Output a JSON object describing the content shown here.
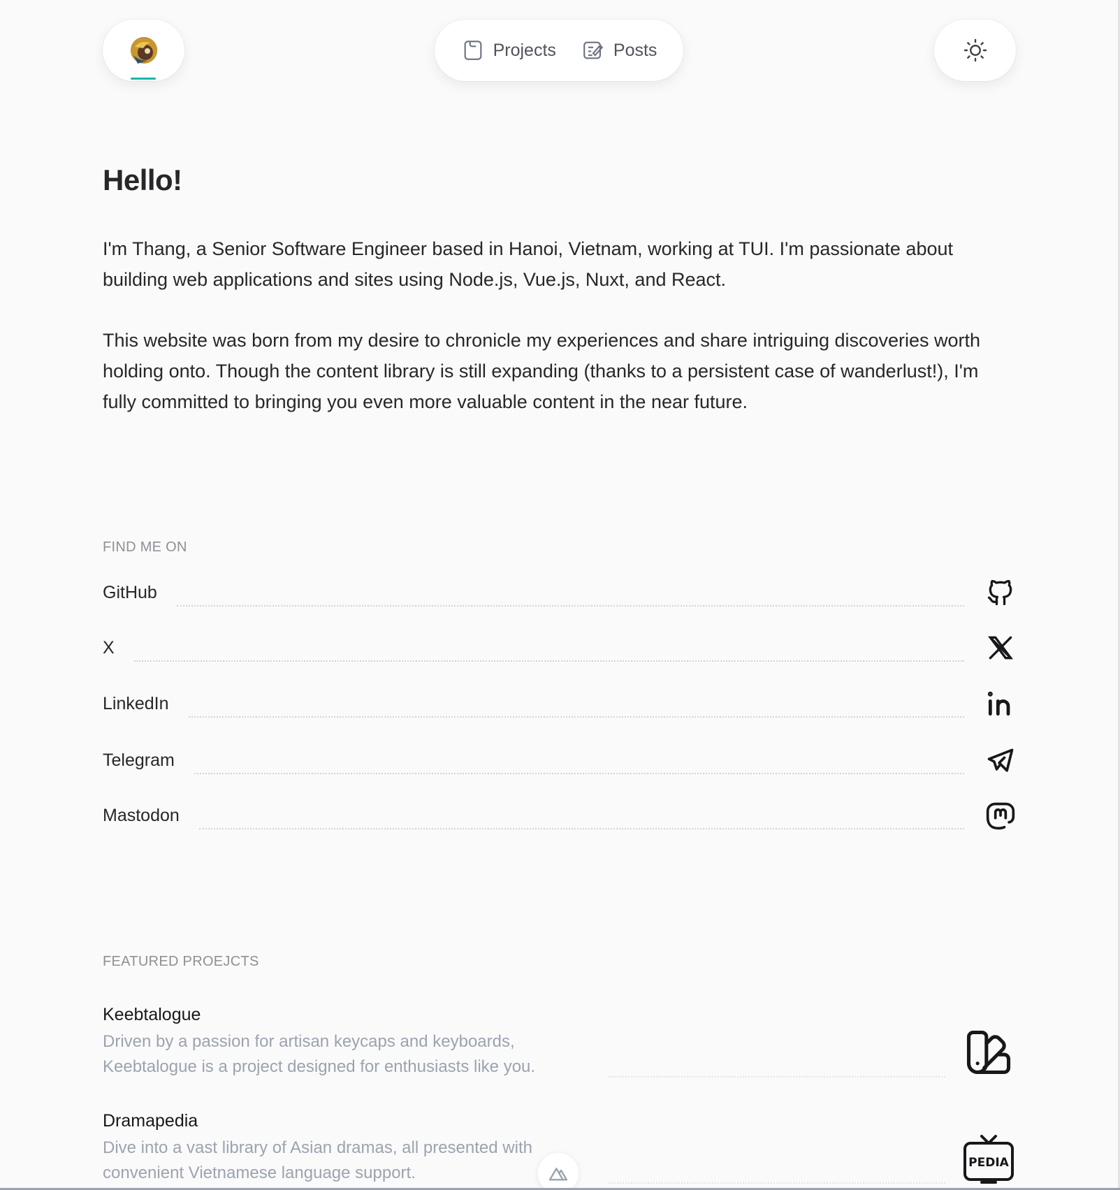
{
  "header": {
    "nav": [
      {
        "label": "Projects",
        "icon": "folder-icon"
      },
      {
        "label": "Posts",
        "icon": "edit-document-icon"
      }
    ],
    "theme_toggle_icon": "sun-icon",
    "accent_color": "#14b8a6"
  },
  "intro": {
    "title": "Hello!",
    "paragraph1": "I'm Thang, a Senior Software Engineer based in Hanoi, Vietnam, working at TUI. I'm passionate about building web applications and sites using Node.js, Vue.js, Nuxt, and React.",
    "paragraph2": "This website was born from my desire to chronicle my experiences and share intriguing discoveries worth holding onto. Though the content library is still expanding (thanks to a persistent case of wanderlust!), I'm fully committed to bringing you even more valuable content in the near future."
  },
  "social": {
    "heading": "FIND ME ON",
    "items": [
      {
        "label": "GitHub",
        "icon": "github-icon"
      },
      {
        "label": "X",
        "icon": "x-icon"
      },
      {
        "label": "LinkedIn",
        "icon": "linkedin-icon"
      },
      {
        "label": "Telegram",
        "icon": "telegram-icon"
      },
      {
        "label": "Mastodon",
        "icon": "mastodon-icon"
      }
    ]
  },
  "featured": {
    "heading": "FEATURED PROEJCTS",
    "items": [
      {
        "title": "Keebtalogue",
        "description": "Driven by a passion for artisan keycaps and keyboards, Keebtalogue is a project designed for enthusiasts like you.",
        "icon": "swatch-book-icon"
      },
      {
        "title": "Dramapedia",
        "description": "Dive into a vast library of Asian dramas, all presented with convenient Vietnamese language support.",
        "icon": "tv-pedia-icon",
        "icon_text": "PEDIA"
      }
    ]
  }
}
